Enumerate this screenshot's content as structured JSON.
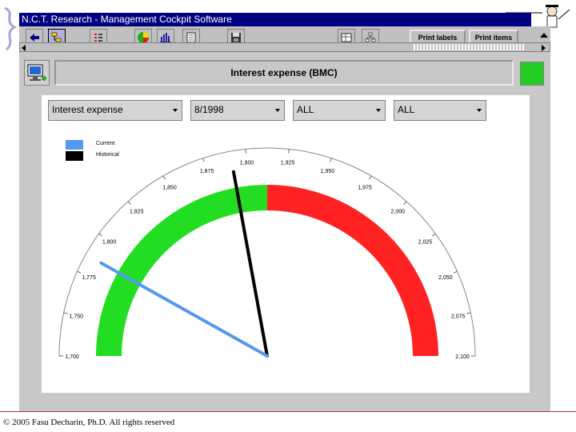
{
  "window": {
    "title": "N.C.T. Research - Management Cockpit Software"
  },
  "toolbar": {
    "print_labels": "Print labels",
    "print_items": "Print items"
  },
  "header": {
    "title": "Interest expense (BMC)",
    "status_color": "#22cc22"
  },
  "filters": [
    {
      "value": "Interest expense"
    },
    {
      "value": "8/1998"
    },
    {
      "value": "ALL"
    },
    {
      "value": "ALL"
    }
  ],
  "legend": [
    {
      "label": "Current",
      "color": "#5599ee"
    },
    {
      "label": "Historical",
      "color": "#000000"
    }
  ],
  "chart_data": {
    "type": "gauge",
    "min": 1700,
    "max": 2100,
    "ticks": [
      "1,700",
      "1,750",
      "1,775",
      "1,800",
      "1,825",
      "1,850",
      "1,875",
      "1,900",
      "1,925",
      "1,950",
      "1,975",
      "2,000",
      "2,025",
      "2,050",
      "2,075",
      "2,100"
    ],
    "bands": [
      {
        "from": 1700,
        "to": 1900,
        "color": "#22dd22"
      },
      {
        "from": 1900,
        "to": 2100,
        "color": "#ff2222"
      }
    ],
    "current": 1765,
    "historical": 1877
  },
  "footer": {
    "copyright": "© 2005 Fasu Decharin, Ph.D. All rights reserved"
  }
}
